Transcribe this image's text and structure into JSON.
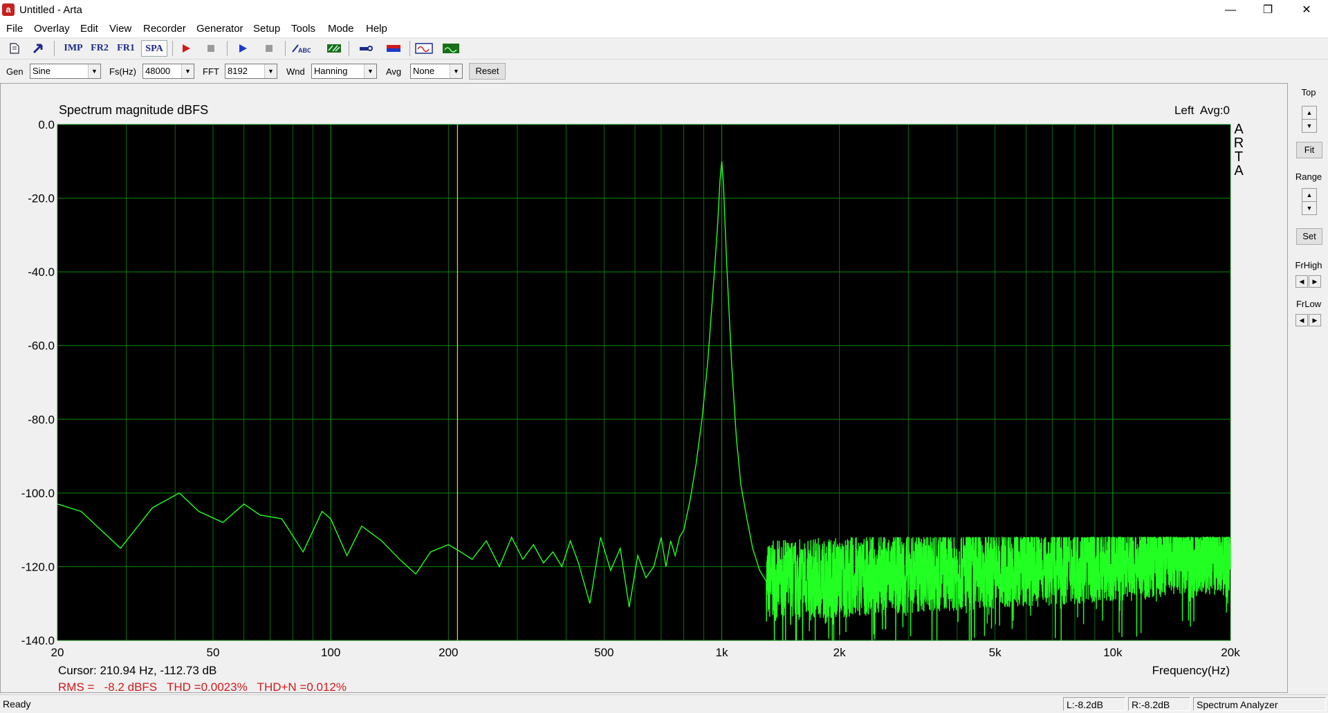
{
  "window": {
    "title": "Untitled - Arta"
  },
  "menu": [
    "File",
    "Overlay",
    "Edit",
    "View",
    "Recorder",
    "Generator",
    "Setup",
    "Tools",
    "Mode",
    "Help"
  ],
  "toolbar": {
    "imp_label": "IMP",
    "fr2_label": "FR2",
    "fr1_label": "FR1",
    "spa_label": "SPA"
  },
  "controls": {
    "gen_label": "Gen",
    "gen_value": "Sine",
    "fs_label": "Fs(Hz)",
    "fs_value": "48000",
    "fft_label": "FFT",
    "fft_value": "8192",
    "wnd_label": "Wnd",
    "wnd_value": "Hanning",
    "avg_label": "Avg",
    "avg_value": "None",
    "reset_label": "Reset"
  },
  "plot": {
    "title": "Spectrum magnitude dBFS",
    "channel_info": "Left  Avg:0",
    "arta_vertical": [
      "A",
      "R",
      "T",
      "A"
    ],
    "cursor_text": "Cursor: 210.94 Hz, -112.73 dB",
    "stats_text": "RMS =   -8.2 dBFS   THD =0.0023%   THD+N =0.012%",
    "x_axis_label": "Frequency(Hz)",
    "colors": {
      "background": "#000000",
      "grid": "#0b8a0b",
      "trace": "#22ff22",
      "cursor": "#d2d24a",
      "stats": "#d21a1a"
    }
  },
  "chart_data": {
    "type": "line",
    "x_scale": "log",
    "xlim": [
      20,
      20000
    ],
    "ylim": [
      -140,
      0
    ],
    "y_ticks": [
      "0.0",
      "-20.0",
      "-40.0",
      "-60.0",
      "-80.0",
      "-100.0",
      "-120.0",
      "-140.0"
    ],
    "x_ticks": [
      {
        "v": 20,
        "label": "20"
      },
      {
        "v": 50,
        "label": "50"
      },
      {
        "v": 100,
        "label": "100"
      },
      {
        "v": 200,
        "label": "200"
      },
      {
        "v": 500,
        "label": "500"
      },
      {
        "v": 1000,
        "label": "1k"
      },
      {
        "v": 2000,
        "label": "2k"
      },
      {
        "v": 5000,
        "label": "5k"
      },
      {
        "v": 10000,
        "label": "10k"
      },
      {
        "v": 20000,
        "label": "20k"
      }
    ],
    "cursor_hz": 210.94,
    "peak": {
      "hz": 1000,
      "db": -10
    },
    "series": [
      {
        "x": [
          20,
          23,
          29,
          35,
          41,
          46,
          53,
          60,
          66,
          75,
          85,
          95,
          100,
          110,
          120,
          135,
          150,
          165,
          180,
          200,
          215,
          230,
          250,
          270,
          290,
          310,
          330,
          350,
          370,
          390,
          410,
          430,
          460,
          490,
          520,
          550,
          580,
          610,
          640,
          670,
          700,
          720,
          740,
          760,
          780,
          800,
          830,
          860,
          890,
          920,
          950,
          975,
          990,
          1000,
          1010,
          1030,
          1060,
          1090,
          1120,
          1160,
          1200,
          1250,
          1300
        ],
        "y": [
          -103,
          -105,
          -115,
          -104,
          -100,
          -105,
          -108,
          -103,
          -106,
          -107,
          -116,
          -105,
          -107,
          -117,
          -109,
          -113,
          -118,
          -122,
          -116,
          -114,
          -116,
          -118,
          -113,
          -120,
          -112,
          -118,
          -114,
          -119,
          -116,
          -120,
          -113,
          -119,
          -130,
          -112,
          -121,
          -115,
          -131,
          -117,
          -123,
          -120,
          -112,
          -120,
          -113,
          -117,
          -112,
          -110,
          -102,
          -92,
          -80,
          -65,
          -45,
          -28,
          -15,
          -10,
          -16,
          -38,
          -65,
          -85,
          -98,
          -107,
          -115,
          -121,
          -124
        ]
      }
    ]
  },
  "right_panel": {
    "top": "Top",
    "fit": "Fit",
    "range": "Range",
    "set": "Set",
    "frhigh": "FrHigh",
    "frlow": "FrLow"
  },
  "status": {
    "ready": "Ready",
    "left_db": "L:-8.2dB",
    "right_db": "R:-8.2dB",
    "mode": "Spectrum Analyzer"
  }
}
